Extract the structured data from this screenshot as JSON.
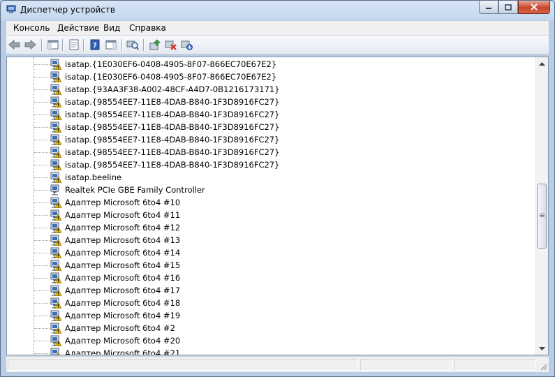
{
  "window": {
    "title": "Диспетчер устройств",
    "title_icon": "device-manager-icon",
    "buttons": [
      "minimize-icon",
      "maximize-icon",
      "close-icon"
    ]
  },
  "menu": [
    "Консоль",
    "Действие",
    "Вид",
    "Справка"
  ],
  "toolbar": [
    "back-arrow-icon",
    "forward-arrow-icon",
    "show-hide-tree-icon",
    "properties-icon",
    "help-icon",
    "action-pane-icon",
    "scan-hardware-icon",
    "update-driver-icon",
    "uninstall-device-icon",
    "enable-device-icon"
  ],
  "devices": [
    {
      "label": "isatap.{1E030EF6-0408-4905-8F07-866EC70E67E2}",
      "warning": true
    },
    {
      "label": "isatap.{1E030EF6-0408-4905-8F07-866EC70E67E2}",
      "warning": true
    },
    {
      "label": "isatap.{93AA3F38-A002-48CF-A4D7-0B1216173171}",
      "warning": true
    },
    {
      "label": "isatap.{98554EE7-11E8-4DAB-B840-1F3D8916FC27}",
      "warning": true
    },
    {
      "label": "isatap.{98554EE7-11E8-4DAB-B840-1F3D8916FC27}",
      "warning": true
    },
    {
      "label": "isatap.{98554EE7-11E8-4DAB-B840-1F3D8916FC27}",
      "warning": true
    },
    {
      "label": "isatap.{98554EE7-11E8-4DAB-B840-1F3D8916FC27}",
      "warning": true
    },
    {
      "label": "isatap.{98554EE7-11E8-4DAB-B840-1F3D8916FC27}",
      "warning": true
    },
    {
      "label": "isatap.{98554EE7-11E8-4DAB-B840-1F3D8916FC27}",
      "warning": true
    },
    {
      "label": "isatap.beeline",
      "warning": true
    },
    {
      "label": "Realtek PCIe GBE Family Controller",
      "warning": false
    },
    {
      "label": "Адаптер Microsoft 6to4 #10",
      "warning": true
    },
    {
      "label": "Адаптер Microsoft 6to4 #11",
      "warning": true
    },
    {
      "label": "Адаптер Microsoft 6to4 #12",
      "warning": true
    },
    {
      "label": "Адаптер Microsoft 6to4 #13",
      "warning": true
    },
    {
      "label": "Адаптер Microsoft 6to4 #14",
      "warning": true
    },
    {
      "label": "Адаптер Microsoft 6to4 #15",
      "warning": true
    },
    {
      "label": "Адаптер Microsoft 6to4 #16",
      "warning": true
    },
    {
      "label": "Адаптер Microsoft 6to4 #17",
      "warning": true
    },
    {
      "label": "Адаптер Microsoft 6to4 #18",
      "warning": true
    },
    {
      "label": "Адаптер Microsoft 6to4 #19",
      "warning": true
    },
    {
      "label": "Адаптер Microsoft 6to4 #2",
      "warning": true
    },
    {
      "label": "Адаптер Microsoft 6to4 #20",
      "warning": true
    },
    {
      "label": "Адаптер Microsoft 6to4 #21",
      "warning": true
    }
  ],
  "device_icon": "network-adapter-icon",
  "warning_icon": "warning-icon",
  "colors": {
    "warning": "#f2c500",
    "adapter_screen": "#3d6fb8",
    "close_button": "#c7462c"
  }
}
